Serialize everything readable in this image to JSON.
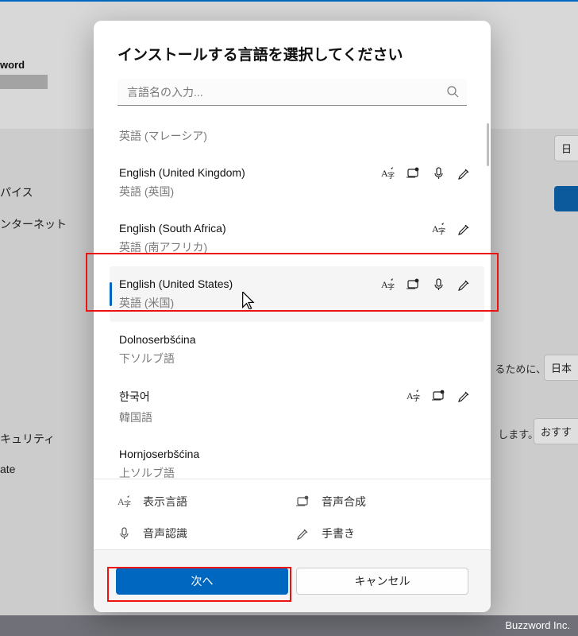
{
  "background": {
    "word_label": "word",
    "nav": [
      "パイス",
      "ンターネット",
      "キュリティ",
      "ate"
    ],
    "right_buttons": {
      "jp1": "日",
      "jp2": "日本",
      "recommend": "おすす"
    },
    "hint1": "るために、",
    "hint2": "します。",
    "footer_brand": "Buzzword Inc."
  },
  "dialog": {
    "title": "インストールする言語を選択してください",
    "search_placeholder": "言語名の入力...",
    "languages": [
      {
        "primary": "",
        "secondary": "英語 (マレーシア)",
        "features": [],
        "partial": true
      },
      {
        "primary": "English (United Kingdom)",
        "secondary": "英語 (英国)",
        "features": [
          "display",
          "tts",
          "speech",
          "hand"
        ]
      },
      {
        "primary": "English (South Africa)",
        "secondary": "英語 (南アフリカ)",
        "features": [
          "display",
          "hand"
        ]
      },
      {
        "primary": "English (United States)",
        "secondary": "英語 (米国)",
        "features": [
          "display",
          "tts",
          "speech",
          "hand"
        ],
        "selected": true
      },
      {
        "primary": "Dolnoserbšćina",
        "secondary": "下ソルブ語",
        "features": []
      },
      {
        "primary": "한국어",
        "secondary": "韓国語",
        "features": [
          "display",
          "tts",
          "hand"
        ]
      },
      {
        "primary": "Hornjoserbšćina",
        "secondary": "上ソルブ語",
        "features": []
      }
    ],
    "legend": {
      "display": "表示言語",
      "tts": "音声合成",
      "speech": "音声認識",
      "hand": "手書き"
    },
    "next": "次へ",
    "cancel": "キャンセル"
  },
  "colors": {
    "accent": "#0067c0",
    "highlight": "#e11"
  }
}
